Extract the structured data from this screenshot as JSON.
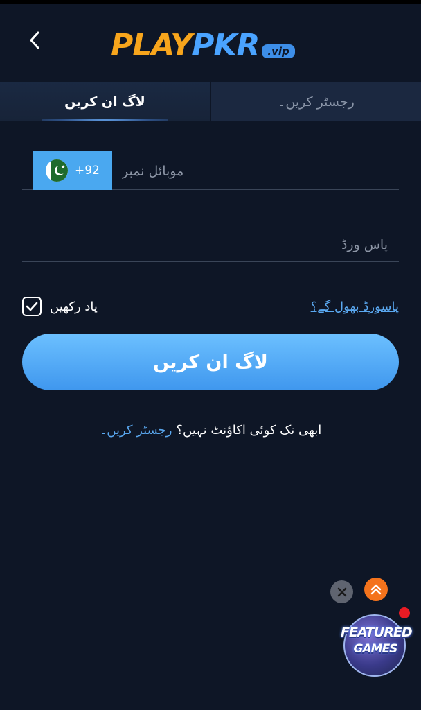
{
  "header": {
    "logo_play": "PLAY",
    "logo_pkr": "PKR",
    "logo_vip": ".vip"
  },
  "tabs": {
    "login": "لاگ ان کریں",
    "register": "رجسٹر کریں۔"
  },
  "form": {
    "country_code": "+92",
    "phone_placeholder": "موبائل نمبر",
    "password_placeholder": "پاس ورڈ",
    "remember_label": "یاد رکھیں",
    "remember_checked": true,
    "forgot_link": "پاسورڈ بھول گے؟",
    "login_button": "لاگ ان کریں"
  },
  "register_prompt": {
    "question": "ابھی تک کوئی اکاؤنٹ نہیں؟",
    "link": "رجسٹر کریں۔"
  },
  "floating": {
    "featured_line1": "FEATURED",
    "featured_line2": "GAMES",
    "colors": {
      "scroll_top": "#f4731c",
      "notification_dot": "#ea1b24"
    }
  },
  "colors": {
    "background": "#0e1626",
    "accent": "#4aa8f0",
    "logo_orange": "#f7a51c",
    "logo_blue": "#4aa3ff"
  },
  "icons": [
    "back-arrow-icon",
    "pakistan-flag-icon",
    "check-icon",
    "close-icon",
    "double-chevron-up-icon"
  ]
}
